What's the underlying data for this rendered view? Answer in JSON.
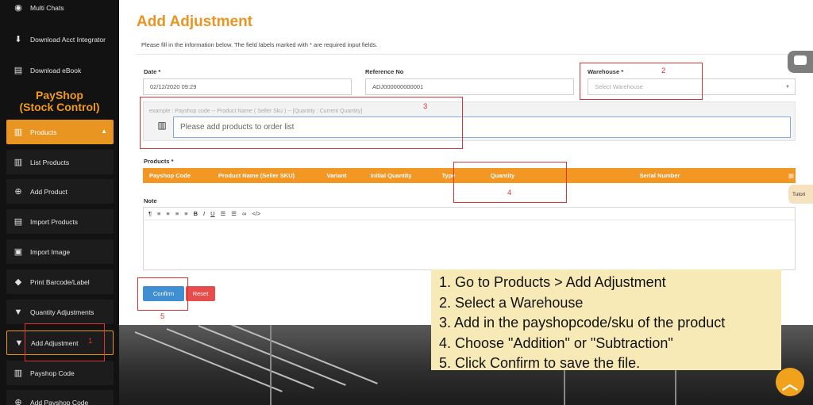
{
  "sidebar": {
    "items_top": [
      {
        "label": "Multi Chats",
        "icon": "messenger-icon"
      },
      {
        "label": "Download Acct Integrator",
        "icon": "download-icon"
      },
      {
        "label": "Download eBook",
        "icon": "book-icon"
      }
    ],
    "brand_line1": "PayShop",
    "brand_line2": "(Stock Control)",
    "products_label": "Products",
    "items": [
      {
        "label": "List Products",
        "icon": "list-icon"
      },
      {
        "label": "Add Product",
        "icon": "plus-circle-icon"
      },
      {
        "label": "Import Products",
        "icon": "file-icon"
      },
      {
        "label": "Import Image",
        "icon": "image-icon"
      },
      {
        "label": "Print Barcode/Label",
        "icon": "tag-icon"
      },
      {
        "label": "Quantity Adjustments",
        "icon": "filter-icon"
      },
      {
        "label": "Add Adjustment",
        "icon": "filter-icon"
      },
      {
        "label": "Payshop Code",
        "icon": "barcode-icon"
      },
      {
        "label": "Add Payshop Code",
        "icon": "plus-circle-icon"
      }
    ]
  },
  "page": {
    "title": "Add Adjustment",
    "intro": "Please fill in the information below. The field labels marked with * are required input fields."
  },
  "form": {
    "date_label": "Date *",
    "date_value": "02/12/2020 09:29",
    "ref_label": "Reference No",
    "ref_value": "ADJ000000000001",
    "warehouse_label": "Warehouse *",
    "warehouse_placeholder": "Select Warehouse",
    "search_hint": "example : Payshop code -- Product Name ( Seller Sku ) -- [Quantity : Current Quantity]",
    "search_placeholder": "Please add products to order list",
    "products_label": "Products *",
    "columns": [
      "Payshop Code",
      "Product Name (Seller SKU)",
      "Variant",
      "Initial Quantity",
      "Type",
      "Quantity",
      "Serial Number"
    ],
    "note_label": "Note",
    "confirm_label": "Confirm",
    "reset_label": "Reset"
  },
  "annotations": [
    "1",
    "2",
    "3",
    "4",
    "5"
  ],
  "tutorial_tab": "Tutori",
  "instructions": [
    "1. Go to Products > Add Adjustment",
    "2. Select a Warehouse",
    "3. Add in the payshopcode/sku of the product",
    "4. Choose \"Addition\" or \"Subtraction\"",
    "5. Click Confirm to save the file."
  ],
  "colors": {
    "accent": "#e89522",
    "confirm": "#3f8fd2",
    "reset": "#e84d4d",
    "annotation": "#dd3333",
    "instructions_bg": "#f8eab6"
  }
}
